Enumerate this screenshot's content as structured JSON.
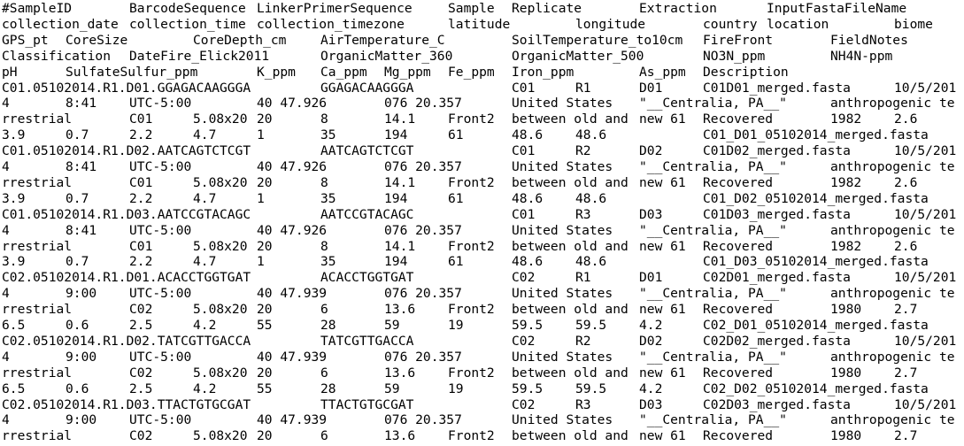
{
  "lines": [
    [
      "#SampleID",
      "BarcodeSequence",
      "LinkerPrimerSequence",
      "Sample",
      "Replicate",
      "Extraction",
      "InputFastaFileName"
    ],
    [
      "collection_date",
      "collection_time",
      "collection_timezone",
      "latitude",
      "longitude",
      "country",
      "location",
      "biome"
    ],
    [
      "GPS_pt",
      "CoreSize",
      "CoreDepth_cm",
      "AirTemperature_C",
      "SoilTemperature_to10cm",
      "FireFront",
      "FieldNotes"
    ],
    [
      "Classification",
      "DateFire_Elick2011",
      "OrganicMatter_360",
      "OrganicMatter_500",
      "NO3N_ppm",
      "NH4N-ppm"
    ],
    [
      "pH",
      "SulfateSulfur_ppm",
      "K_ppm",
      "Ca_ppm",
      "Mg_ppm",
      "Fe_ppm",
      "Iron_ppm",
      "As_ppm",
      "Description"
    ],
    [
      "C01.05102014.R1.D01.GGAGACAAGGGA",
      "GGAGACAAGGGA",
      "C01",
      "R1",
      "D01",
      "C01D01_merged.fasta",
      "10/5/201"
    ],
    [
      "4",
      "8:41",
      "UTC-5:00",
      "40 47.926",
      "076 20.357",
      "United States",
      "\"__Centralia, PA__\"",
      "anthropogenic te"
    ],
    [
      "rrestrial",
      "C01",
      "5.08x20",
      "20",
      "8",
      "14.1",
      "Front2",
      "between old and",
      "new 61",
      "Recovered",
      "1982",
      "2.6"
    ],
    [
      "3.9",
      "0.7",
      "2.2",
      "4.7",
      "1",
      "35",
      "194",
      "61",
      "48.6",
      "48.6",
      "C01_D01_05102014_merged.fasta"
    ],
    [
      "C01.05102014.R1.D02.AATCAGTCTCGT",
      "AATCAGTCTCGT",
      "C01",
      "R2",
      "D02",
      "C01D02_merged.fasta",
      "10/5/201"
    ],
    [
      "4",
      "8:41",
      "UTC-5:00",
      "40 47.926",
      "076 20.357",
      "United States",
      "\"__Centralia, PA__\"",
      "anthropogenic te"
    ],
    [
      "rrestrial",
      "C01",
      "5.08x20",
      "20",
      "8",
      "14.1",
      "Front2",
      "between old and",
      "new 61",
      "Recovered",
      "1982",
      "2.6"
    ],
    [
      "3.9",
      "0.7",
      "2.2",
      "4.7",
      "1",
      "35",
      "194",
      "61",
      "48.6",
      "48.6",
      "C01_D02_05102014_merged.fasta"
    ],
    [
      "C01.05102014.R1.D03.AATCCGTACAGC",
      "AATCCGTACAGC",
      "C01",
      "R3",
      "D03",
      "C01D03_merged.fasta",
      "10/5/201"
    ],
    [
      "4",
      "8:41",
      "UTC-5:00",
      "40 47.926",
      "076 20.357",
      "United States",
      "\"__Centralia, PA__\"",
      "anthropogenic te"
    ],
    [
      "rrestrial",
      "C01",
      "5.08x20",
      "20",
      "8",
      "14.1",
      "Front2",
      "between old and",
      "new 61",
      "Recovered",
      "1982",
      "2.6"
    ],
    [
      "3.9",
      "0.7",
      "2.2",
      "4.7",
      "1",
      "35",
      "194",
      "61",
      "48.6",
      "48.6",
      "C01_D03_05102014_merged.fasta"
    ],
    [
      "C02.05102014.R1.D01.ACACCTGGTGAT",
      "ACACCTGGTGAT",
      "C02",
      "R1",
      "D01",
      "C02D01_merged.fasta",
      "10/5/201"
    ],
    [
      "4",
      "9:00",
      "UTC-5:00",
      "40 47.939",
      "076 20.357",
      "United States",
      "\"__Centralia, PA__\"",
      "anthropogenic te"
    ],
    [
      "rrestrial",
      "C02",
      "5.08x20",
      "20",
      "6",
      "13.6",
      "Front2",
      "between old and",
      "new 61",
      "Recovered",
      "1980",
      "2.7"
    ],
    [
      "6.5",
      "0.6",
      "2.5",
      "4.2",
      "55",
      "28",
      "59",
      "19",
      "59.5",
      "59.5",
      "4.2",
      "C02_D01_05102014_merged.fasta"
    ],
    [
      "C02.05102014.R1.D02.TATCGTTGACCA",
      "TATCGTTGACCA",
      "C02",
      "R2",
      "D02",
      "C02D02_merged.fasta",
      "10/5/201"
    ],
    [
      "4",
      "9:00",
      "UTC-5:00",
      "40 47.939",
      "076 20.357",
      "United States",
      "\"__Centralia, PA__\"",
      "anthropogenic te"
    ],
    [
      "rrestrial",
      "C02",
      "5.08x20",
      "20",
      "6",
      "13.6",
      "Front2",
      "between old and",
      "new 61",
      "Recovered",
      "1980",
      "2.7"
    ],
    [
      "6.5",
      "0.6",
      "2.5",
      "4.2",
      "55",
      "28",
      "59",
      "19",
      "59.5",
      "59.5",
      "4.2",
      "C02_D02_05102014_merged.fasta"
    ],
    [
      "C02.05102014.R1.D03.TTACTGTGCGAT",
      "TTACTGTGCGAT",
      "C02",
      "R3",
      "D03",
      "C02D03_merged.fasta",
      "10/5/201"
    ],
    [
      "4",
      "9:00",
      "UTC-5:00",
      "40 47.939",
      "076 20.357",
      "United States",
      "\"__Centralia, PA__\"",
      "anthropogenic te"
    ],
    [
      "rrestrial",
      "C02",
      "5.08x20",
      "20",
      "6",
      "13.6",
      "Front2",
      "between old and",
      "new 61",
      "Recovered",
      "1980",
      "2.7"
    ]
  ]
}
